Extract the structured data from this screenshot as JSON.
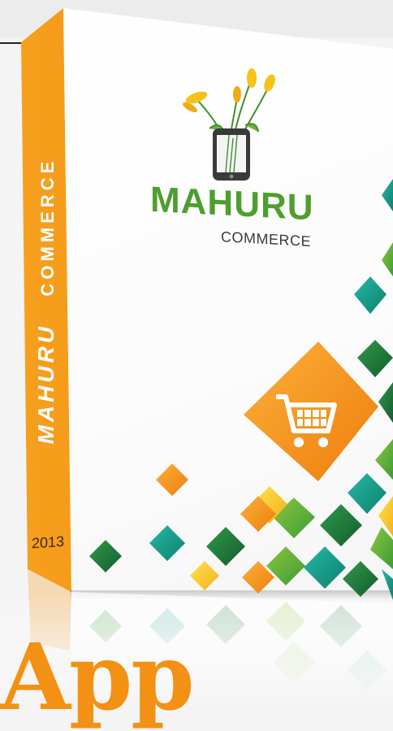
{
  "box": {
    "brand_name": "MAHURU",
    "brand_sub": "COMMERCE",
    "spine_brand": "MAHURU",
    "spine_sub": "COMMERCE",
    "spine_year": "2013"
  },
  "caption": {
    "text": "App"
  },
  "colors": {
    "orange": "#f39114",
    "green": "#4e9e2f",
    "teal": "#17a594",
    "dark_green": "#1f7a3f"
  },
  "icons": [
    "mobile-phone-icon",
    "flower-icon",
    "shopping-cart-icon"
  ]
}
